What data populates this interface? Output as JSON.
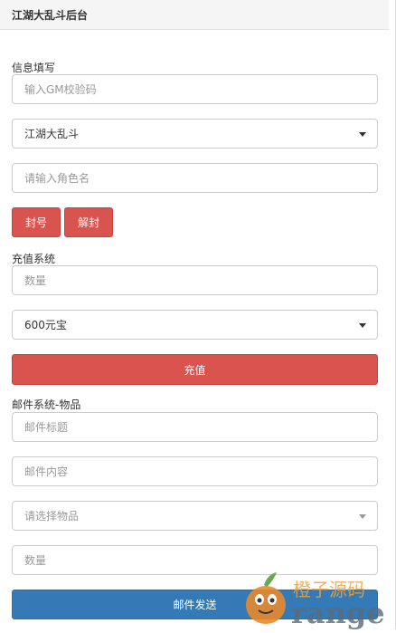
{
  "header": {
    "title": "江湖大乱斗后台"
  },
  "info": {
    "label": "信息填写",
    "gm_code_placeholder": "输入GM校验码",
    "server_selected": "江湖大乱斗",
    "role_placeholder": "请输入角色名",
    "ban_label": "封号",
    "unban_label": "解封"
  },
  "recharge": {
    "label": "充值系统",
    "amount_placeholder": "数量",
    "package_selected": "600元宝",
    "submit_label": "充值"
  },
  "mail": {
    "label": "邮件系统-物品",
    "title_placeholder": "邮件标题",
    "content_placeholder": "邮件内容",
    "item_placeholder": "请选择物品",
    "count_placeholder": "数量",
    "send_label": "邮件发送"
  },
  "watermark": {
    "cn_text": "橙子源码",
    "en_text": "range"
  },
  "colors": {
    "danger": "#d9534f",
    "primary": "#337ab7",
    "watermark": "#f0a040"
  }
}
